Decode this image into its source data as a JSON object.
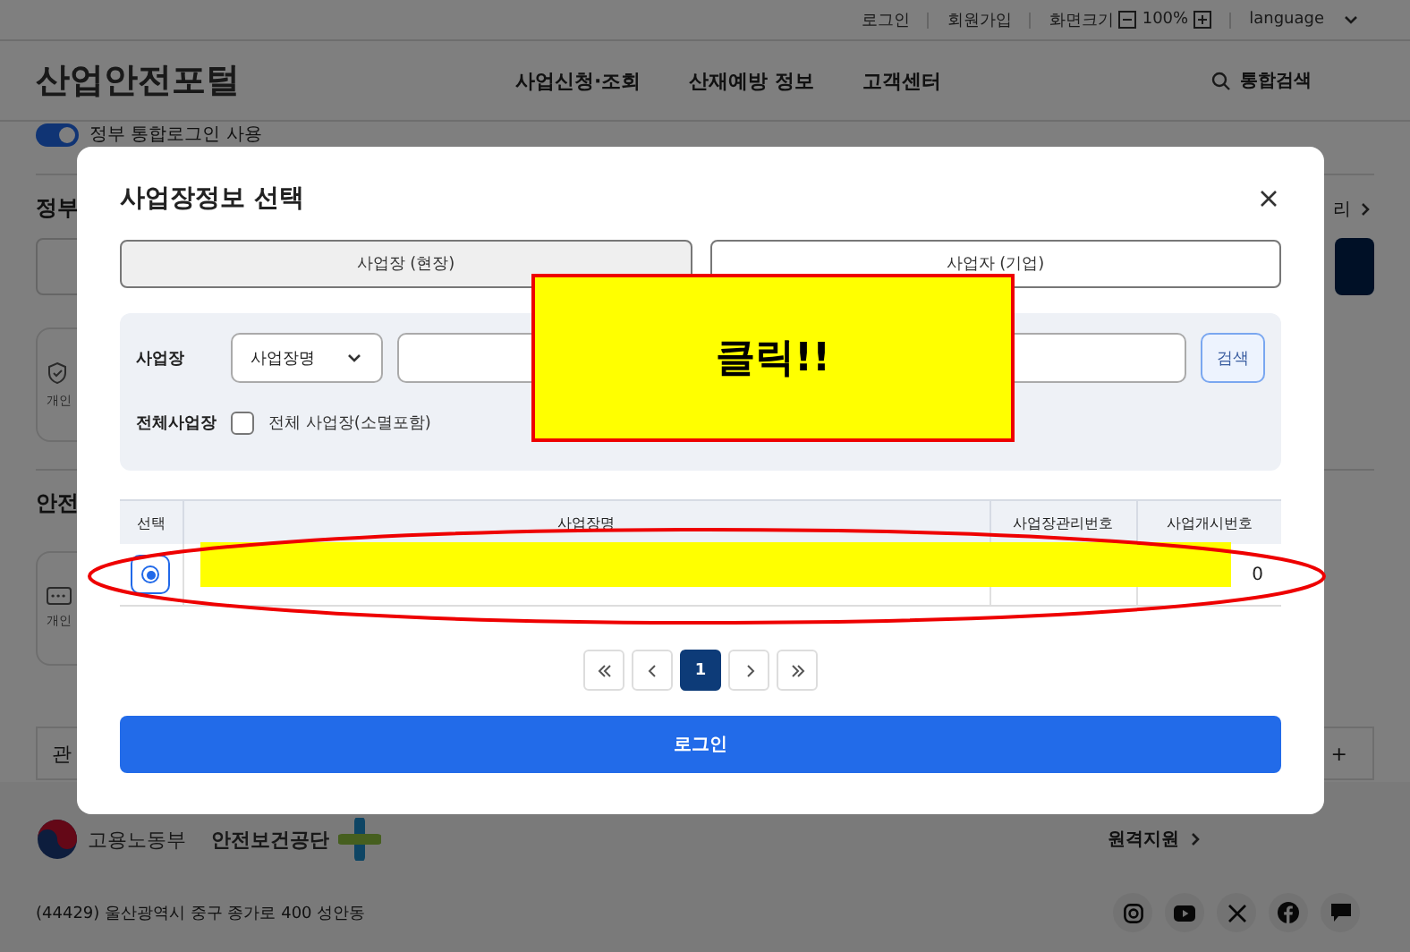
{
  "utility_bar": {
    "links": [
      "로그인",
      "회원가입"
    ],
    "zoom_label": "화면크기",
    "zoom_value": "100%",
    "language": "language"
  },
  "header": {
    "logo": "산업안전포털",
    "nav": [
      "사업신청·조회",
      "산재예방 정보",
      "고객센터"
    ],
    "search": "통합검색"
  },
  "background": {
    "toggle": {
      "label": "정부 통합로그인 사용",
      "on": true
    },
    "section_1": "정부",
    "more_link": "리",
    "card_1": "개인",
    "section_2": "안전",
    "card_2": "개인",
    "bar_text": "관",
    "bar_plus": "+"
  },
  "modal": {
    "title": "사업장정보 선택",
    "tabs": [
      {
        "label": "사업장 (현장)",
        "selected": true
      },
      {
        "label": "사업자 (기업)",
        "selected": false
      }
    ],
    "filter": {
      "site_label": "사업장",
      "select_value": "사업장명",
      "search_button": "검색",
      "all_label": "전체사업장",
      "all_checkbox": {
        "label": "전체 사업장(소멸포함)",
        "checked": false
      }
    },
    "table": {
      "columns": [
        "선택",
        "사업장명",
        "사업장관리번호",
        "사업개시번호"
      ],
      "rows": [
        {
          "selected": true,
          "column_4": "0"
        }
      ]
    },
    "pagination": {
      "pages": [
        {
          "label": "1",
          "selected": true
        }
      ]
    },
    "login_button": "로그인"
  },
  "annotation": {
    "callout": "클릭!!"
  },
  "footer": {
    "org_1": "고용노동부",
    "org_2": "안전보건공단",
    "remote_support": "원격지원",
    "address": "(44429) 울산광역시 중구 종가로 400 성안동"
  }
}
